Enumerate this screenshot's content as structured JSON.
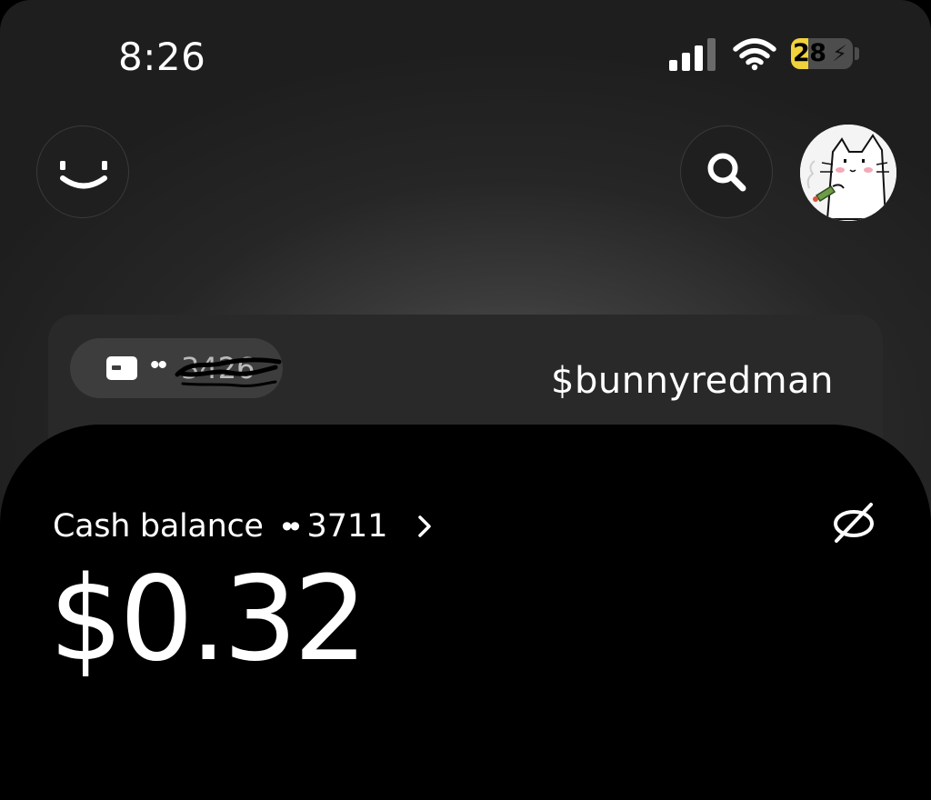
{
  "status_bar": {
    "time": "8:26",
    "battery_percent": "28",
    "battery_level": 0.28,
    "battery_color": "#f2d23c",
    "signal_icon": "cellular-signal-icon",
    "wifi_icon": "wifi-icon",
    "charging_icon": "bolt-icon"
  },
  "header": {
    "left_icon": "smiley-icon",
    "search_icon": "search-icon",
    "avatar": "profile-avatar"
  },
  "card": {
    "card_icon": "credit-card-icon",
    "dots": "••",
    "masked_number": "3426",
    "cashtag": "$bunnyredman"
  },
  "balance_section": {
    "label": "Cash balance",
    "dots": "••",
    "account_last4": "3711",
    "chevron_icon": "chevron-right-icon",
    "hide_icon": "eye-off-icon",
    "amount": "$0.32"
  }
}
